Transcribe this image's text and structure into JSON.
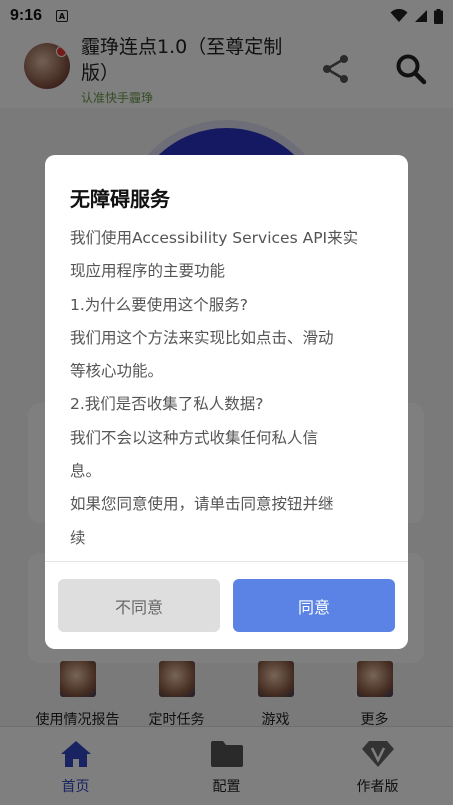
{
  "status_bar": {
    "time": "9:16",
    "notification_glyph": "A"
  },
  "header": {
    "title_line1": "霾琤连点1.0（至尊定制",
    "title_line2": "版）",
    "subtitle": "认准快手霾琤",
    "share_icon": "share-icon",
    "search_icon": "search-icon"
  },
  "quick_actions": [
    {
      "label": "使用情况报告"
    },
    {
      "label": "定时任务"
    },
    {
      "label": "游戏"
    },
    {
      "label": "更多"
    }
  ],
  "bottom_nav": [
    {
      "label": "首页",
      "icon": "home-icon",
      "active": true
    },
    {
      "label": "配置",
      "icon": "folder-icon",
      "active": false
    },
    {
      "label": "作者版",
      "icon": "vip-diamond-icon",
      "active": false
    }
  ],
  "dialog": {
    "title": "无障碍服务",
    "lines": [
      "我们使用Accessibility Services API来实",
      "现应用程序的主要功能",
      "1.为什么要使用这个服务?",
      "我们用这个方法来实现比如点击、滑动",
      "等核心功能。",
      "2.我们是否收集了私人数据?",
      "我们不会以这种方式收集任何私人信",
      "息。",
      "如果您同意使用，请单击同意按钮并继",
      "续"
    ],
    "cancel_label": "不同意",
    "ok_label": "同意"
  },
  "colors": {
    "accent": "#5b82e5",
    "nav_active": "#3346c4",
    "circle": "#2b32c4"
  }
}
